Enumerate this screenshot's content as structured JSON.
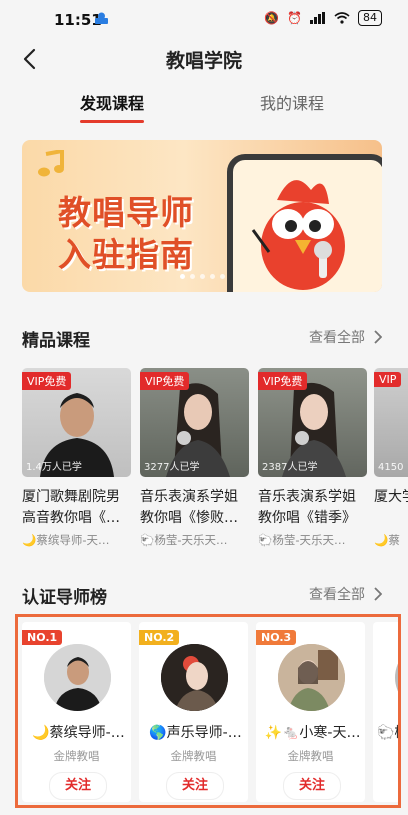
{
  "status_bar": {
    "time": "11:51",
    "battery": "84"
  },
  "header": {
    "title": "教唱学院"
  },
  "tabs": [
    {
      "label": "发现课程"
    },
    {
      "label": "我的课程"
    }
  ],
  "banner": {
    "line1": "教唱导师",
    "line2": "入驻指南",
    "page_count": 5,
    "active_page": 1
  },
  "featured": {
    "title": "精品课程",
    "more": "查看全部",
    "courses": [
      {
        "badge": "VIP免费",
        "count": "1.4万人已学",
        "name": "厦门歌舞剧院男高音教你唱《…",
        "teacher": "🌙蔡缤导师-天…"
      },
      {
        "badge": "VIP免费",
        "count": "3277人已学",
        "name": "音乐表演系学姐教你唱《惨败…",
        "teacher": "🐑杨莹-天乐天…"
      },
      {
        "badge": "VIP免费",
        "count": "2387人已学",
        "name": "音乐表演系学姐教你唱《错季》",
        "teacher": "🐑杨莹-天乐天…"
      },
      {
        "badge": "VIP",
        "count": "4150",
        "name": "厦大学长",
        "teacher": "🌙蔡"
      }
    ]
  },
  "ranking": {
    "title": "认证导师榜",
    "more": "查看全部",
    "mentors": [
      {
        "rank": "NO.1",
        "name": "🌙蔡缤导师-…",
        "label": "金牌教唱",
        "follow": "关注"
      },
      {
        "rank": "NO.2",
        "name": "🌎声乐导师-…",
        "label": "金牌教唱",
        "follow": "关注"
      },
      {
        "rank": "NO.3",
        "name": "✨🐁小寒-天…",
        "label": "金牌教唱",
        "follow": "关注"
      },
      {
        "rank": "",
        "name": "🐑杨",
        "label": "",
        "follow": ""
      }
    ]
  },
  "colors": {
    "accent": "#e22b2b",
    "highlight_border": "#ec6a3c",
    "no1": "#e8432e",
    "no2": "#f2b01e",
    "no3": "#f07a3a"
  }
}
